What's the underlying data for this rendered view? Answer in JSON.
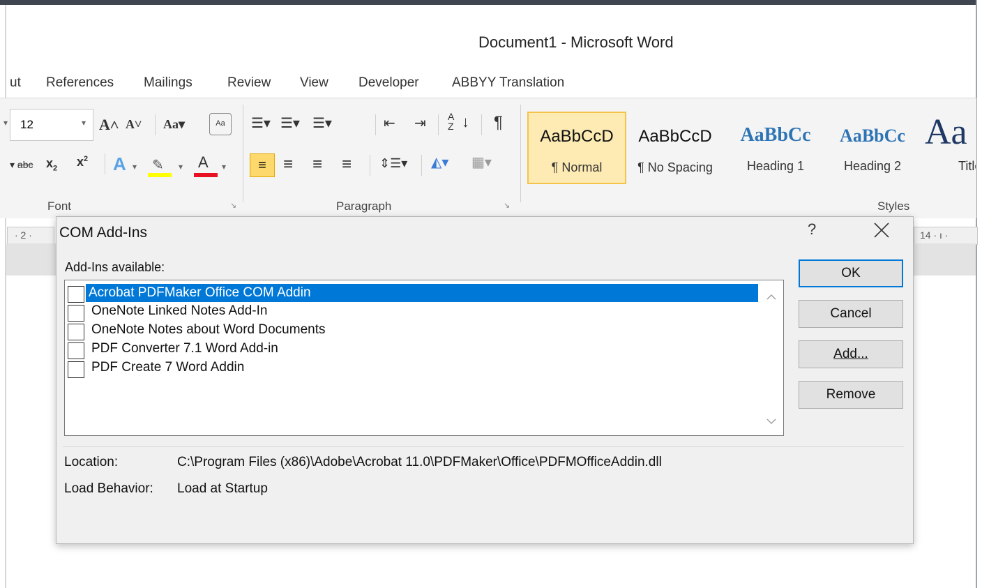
{
  "window": {
    "title": "Document1 - Microsoft Word"
  },
  "menu": {
    "tabs": [
      "ut",
      "References",
      "Mailings",
      "Review",
      "View",
      "Developer",
      "ABBYY Translation"
    ]
  },
  "ribbon": {
    "font_size": "12",
    "font_group": "Font",
    "paragraph_group": "Paragraph",
    "styles_group": "Styles",
    "styles": [
      {
        "preview": "AaBbCcD",
        "label": "¶ Normal"
      },
      {
        "preview": "AaBbCcD",
        "label": "¶ No Spacing"
      },
      {
        "preview": "AaBbCc",
        "label": "Heading 1"
      },
      {
        "preview": "AaBbCc",
        "label": "Heading 2"
      },
      {
        "preview": "Aa",
        "label": "Title"
      }
    ],
    "ruler_left": "· 2 ·",
    "ruler_right": "14 · ı ·"
  },
  "dialog": {
    "title": "COM Add-Ins",
    "help": "?",
    "available_label": "Add-Ins available:",
    "addins": [
      {
        "label": "Acrobat PDFMaker Office COM Addin",
        "checked": false,
        "selected": true
      },
      {
        "label": "OneNote Linked Notes Add-In",
        "checked": false,
        "selected": false
      },
      {
        "label": "OneNote Notes about Word Documents",
        "checked": false,
        "selected": false
      },
      {
        "label": "PDF Converter 7.1 Word Add-in",
        "checked": false,
        "selected": false
      },
      {
        "label": "PDF Create 7 Word Addin",
        "checked": false,
        "selected": false
      }
    ],
    "buttons": {
      "ok": "OK",
      "cancel": "Cancel",
      "add": "Add...",
      "remove": "Remove"
    },
    "location_label": "Location:",
    "location_value": "C:\\Program Files (x86)\\Adobe\\Acrobat 11.0\\PDFMaker\\Office\\PDFMOfficeAddin.dll",
    "load_label": "Load Behavior:",
    "load_value": "Load at Startup"
  },
  "colors": {
    "selection": "#0078d7",
    "style_highlight": "#fdebb3",
    "heading_blue": "#2e74b5"
  }
}
